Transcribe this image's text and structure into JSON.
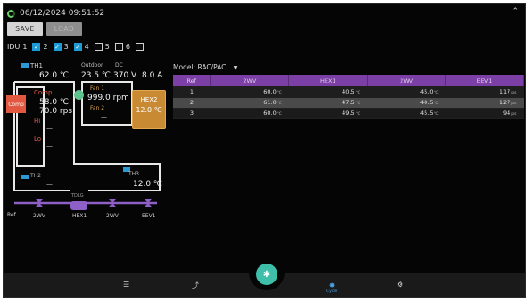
{
  "header": {
    "datetime": "06/12/2024 09:51:52"
  },
  "toolbar": {
    "save_label": "SAVE",
    "load_label": "LOAD"
  },
  "idu": {
    "label": "IDU",
    "units": [
      {
        "num": "1",
        "checked": true
      },
      {
        "num": "2",
        "checked": true
      },
      {
        "num": "3",
        "checked": true
      },
      {
        "num": "4",
        "checked": false
      },
      {
        "num": "5",
        "checked": false
      },
      {
        "num": "6",
        "checked": false
      }
    ]
  },
  "diagram": {
    "th1_label": "TH1",
    "th1_value": "62.0 ℃",
    "outdoor_label": "Outdoor",
    "outdoor_value": "23.5 ℃",
    "dc_label": "DC",
    "dc_voltage": "370 V",
    "dc_current": "8.0 A",
    "comp_label": "Comp",
    "comp_box_label": "Comp",
    "comp_temp": "58.0 ℃",
    "comp_rps": "70.0 rps",
    "hi_label": "Hi",
    "hi_value": "—",
    "lo_label": "Lo",
    "lo_value": "—",
    "fan1_label": "Fan 1",
    "fan1_value": "999.0 rpm",
    "fan2_label": "Fan 2",
    "fan2_value": "—",
    "hex2_label": "HEX2",
    "hex2_value": "12.0 ℃",
    "th2_label": "TH2",
    "th2_value": "—",
    "th3_label": "TH3",
    "th3_value": "12.0 ℃",
    "tdlg_label": "TDLG",
    "pipe_labels": [
      "Ref",
      "2WV",
      "HEX1",
      "2WV",
      "EEV1"
    ]
  },
  "model": {
    "label": "Model:",
    "value": "RAC/PAC"
  },
  "table": {
    "headers": [
      "Ref",
      "2WV",
      "HEX1",
      "2WV",
      "EEV1"
    ],
    "rows": [
      {
        "ref": "1",
        "c1": "60.0",
        "c2": "40.5",
        "c3": "45.0",
        "c4": "117"
      },
      {
        "ref": "2",
        "c1": "61.0",
        "c2": "47.5",
        "c3": "40.5",
        "c4": "127"
      },
      {
        "ref": "3",
        "c1": "60.0",
        "c2": "49.5",
        "c3": "45.5",
        "c4": "94"
      }
    ],
    "unit_temp": "℃",
    "unit_pulse": "ps"
  },
  "nav": {
    "cycle_label": "Cycle"
  },
  "colors": {
    "accent_purple": "#7b3fa5",
    "fab": "#3fbfa9",
    "comp": "#e1573f",
    "hex2": "#c98a34"
  }
}
